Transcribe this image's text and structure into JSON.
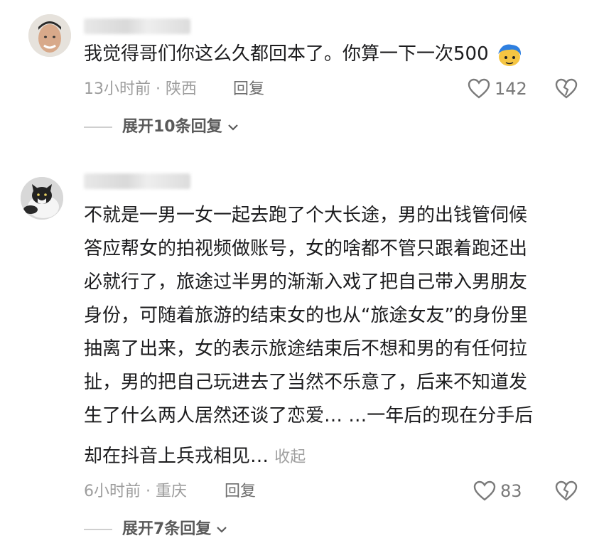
{
  "comments": [
    {
      "text": "我觉得哥们你这么久都回本了。你算一下一次500",
      "time_location": "13小时前 · 陕西",
      "reply_label": "回复",
      "likes": "142",
      "expand_label": "展开10条回复"
    },
    {
      "lines": [
        "不就是一男一女一起去跑了个大长途，男的出钱管伺候",
        "答应帮女的拍视频做账号，女的啥都不管只跟着跑还出",
        "必就行了，旅途过半男的渐渐入戏了把自己带入男朋友",
        "身份，可随着旅游的结束女的也从“旅途女友”的身份里",
        "抽离了出来，女的表示旅途结束后不想和男的有任何拉",
        "扯，男的把自己玩进去了当然不乐意了，后来不知道发",
        "生了什么两人居然还谈了恋爱… …一年后的现在分手后",
        "却在抖音上兵戎相见…"
      ],
      "collapse_label": "收起",
      "time_location": "6小时前 · 重庆",
      "reply_label": "回复",
      "likes": "83",
      "expand_label": "展开7条回复"
    }
  ]
}
